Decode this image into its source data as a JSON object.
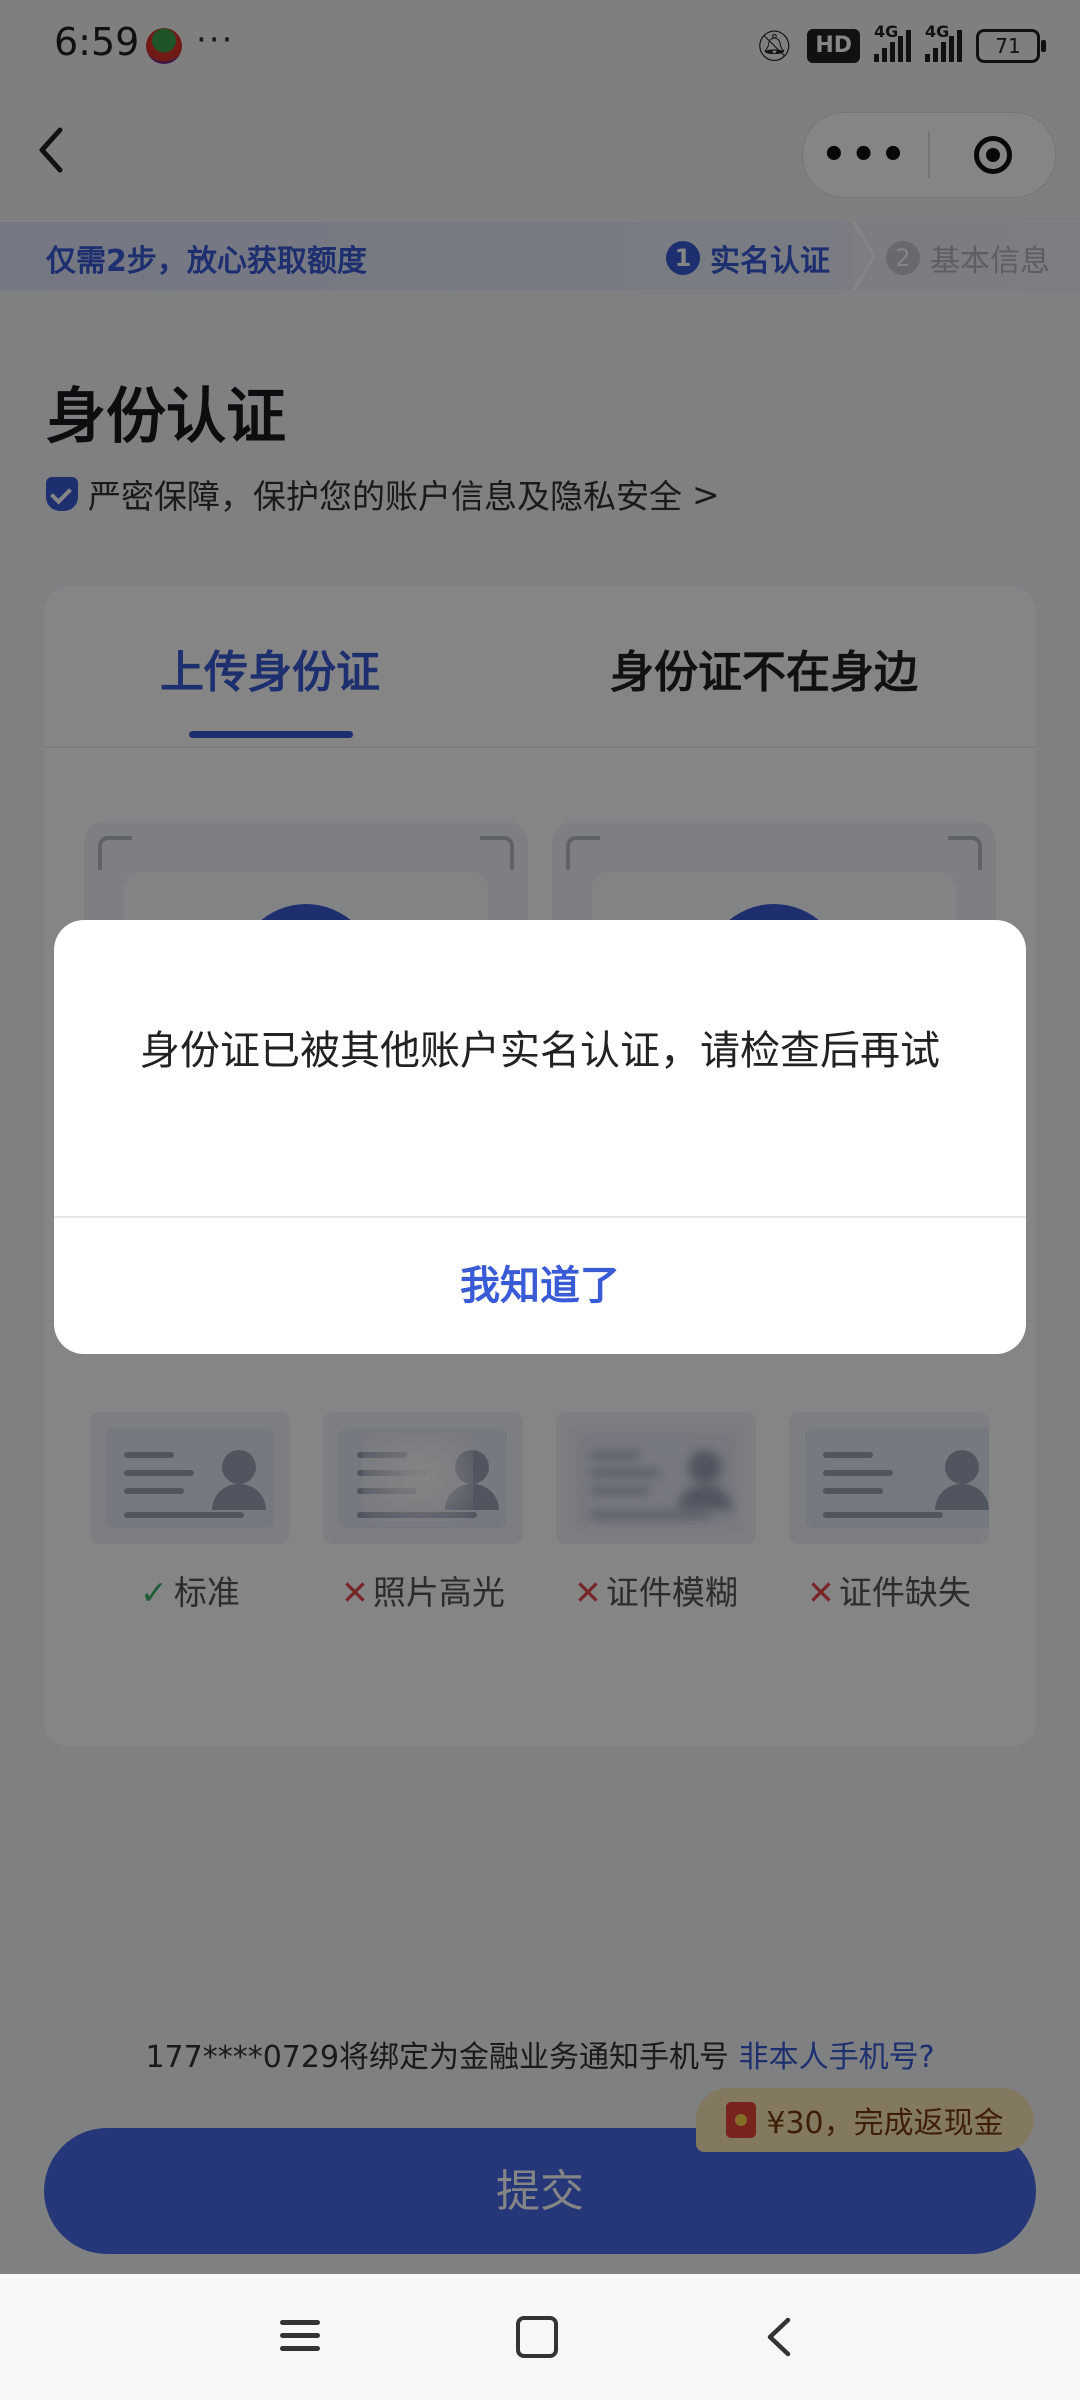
{
  "status_bar": {
    "time": "6:59",
    "more": "···",
    "hd_label": "HD",
    "network_1": "4G",
    "network_2": "4G",
    "battery": "71"
  },
  "nav": {
    "back_icon": "chevron-left-icon",
    "more_icon": "more-dots-icon",
    "close_icon": "target-close-icon"
  },
  "banner": {
    "text": "仅需2步，放心获取额度",
    "steps": [
      {
        "num": "1",
        "label": "实名认证",
        "state": "active"
      },
      {
        "num": "2",
        "label": "基本信息",
        "state": "inactive"
      }
    ]
  },
  "header": {
    "title": "身份认证",
    "security_text": "严密保障，保护您的账户信息及隐私安全",
    "security_chevron": ">"
  },
  "card": {
    "tabs": [
      {
        "label": "上传身份证",
        "active": true
      },
      {
        "label": "身份证不在身边",
        "active": false
      }
    ],
    "samples": [
      {
        "mark": "✓",
        "label": "标准",
        "ok": true
      },
      {
        "mark": "✕",
        "label": "照片高光",
        "ok": false
      },
      {
        "mark": "✕",
        "label": "证件模糊",
        "ok": false
      },
      {
        "mark": "✕",
        "label": "证件缺失",
        "ok": false
      }
    ]
  },
  "footer": {
    "phone_note": "177****0729将绑定为金融业务通知手机号",
    "phone_link": "非本人手机号?",
    "reward": "¥30，完成返现金",
    "submit": "提交"
  },
  "dialog": {
    "message": "身份证已被其他账户实名认证，请检查后再试",
    "confirm": "我知道了"
  },
  "colors": {
    "accent": "#3a5bd6",
    "submit": "#4a6ae8",
    "ok": "#3bb26b",
    "bad": "#e54848"
  }
}
